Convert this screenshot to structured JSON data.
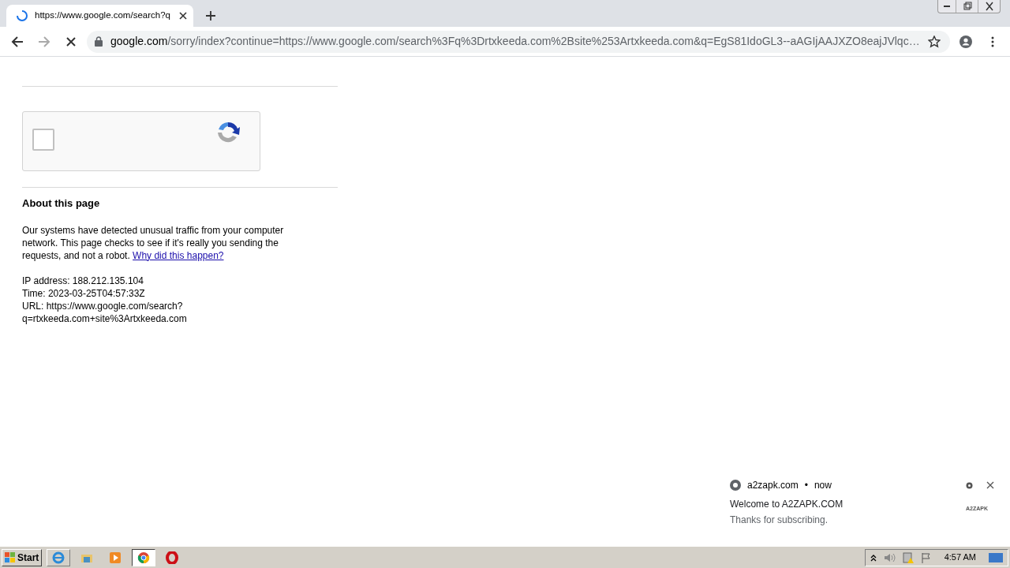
{
  "browser": {
    "tab": {
      "title": "https://www.google.com/search?q",
      "loading": true
    },
    "address_bar": {
      "host": "google.com",
      "path": "/sorry/index?continue=https://www.google.com/search%3Fq%3Drtxkeeda.com%2Bsite%253Artxkeeda.com&q=EgS81IdoGL3--aAGIjAAJXZO8eajJVlqc…",
      "secure": true
    }
  },
  "page": {
    "captcha": {
      "checked": false
    },
    "heading": "About this page",
    "message": "Our systems have detected unusual traffic from your computer network. This page checks to see if it's really you sending the requests, and not a robot.",
    "link": "Why did this happen?",
    "details": [
      "IP address: 188.212.135.104",
      "Time: 2023-03-25T04:57:33Z",
      "URL: https://www.google.com/search?",
      "q=rtxkeeda.com+site%3Artxkeeda.com"
    ]
  },
  "notification": {
    "source": "a2zapk.com",
    "separator": "•",
    "time": "now",
    "title": "Welcome to A2ZAPK.COM",
    "body": "Thanks for subscribing.",
    "badge": "A2ZAPK"
  },
  "taskbar": {
    "start": "Start",
    "apps": [
      {
        "kind": "ie",
        "selected": false
      },
      {
        "kind": "explorer",
        "selected": false
      },
      {
        "kind": "media",
        "selected": false
      },
      {
        "kind": "chrome",
        "selected": true
      },
      {
        "kind": "opera",
        "selected": false
      }
    ],
    "clock": "4:57 AM"
  }
}
